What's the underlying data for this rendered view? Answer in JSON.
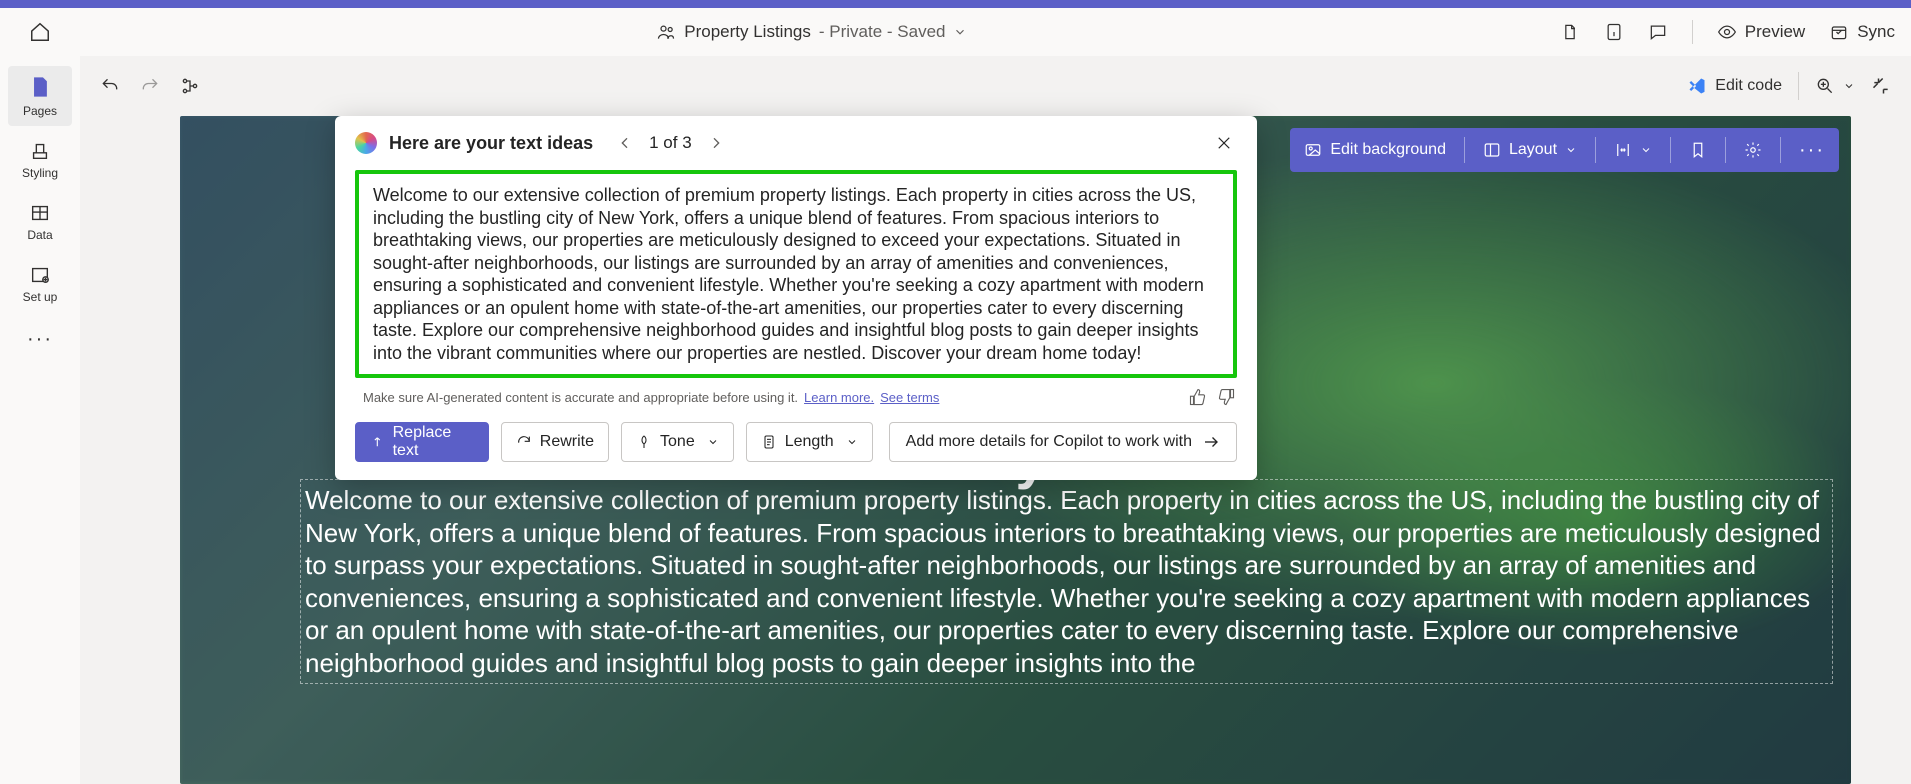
{
  "titlebar": {
    "doc_name": "Property Listings",
    "doc_status": "- Private - Saved",
    "preview": "Preview",
    "sync": "Sync"
  },
  "leftbar": {
    "pages": "Pages",
    "styling": "Styling",
    "data": "Data",
    "setup": "Set up"
  },
  "toolbar": {
    "edit_code": "Edit code"
  },
  "edit_strip": {
    "edit_bg": "Edit background",
    "layout": "Layout"
  },
  "hero": {
    "title_fragment": "cy",
    "body": "Welcome to our extensive collection of premium property listings. Each property in cities across the US, including the bustling city of New York, offers a unique blend of features. From spacious interiors to breathtaking views, our properties are meticulously designed to surpass your expectations. Situated in sought-after neighborhoods, our listings are surrounded by an array of amenities and conveniences, ensuring a sophisticated and convenient lifestyle. Whether you're seeking a cozy apartment with modern appliances or an opulent home with state-of-the-art amenities, our properties cater to every discerning taste. Explore our comprehensive neighborhood guides and insightful blog posts to gain deeper insights into the"
  },
  "popup": {
    "title": "Here are your text ideas",
    "pager": "1 of 3",
    "idea_text": "Welcome to our extensive collection of premium property listings. Each property in cities across the US, including the bustling city of New York, offers a unique blend of features. From spacious interiors to breathtaking views, our properties are meticulously designed to exceed your expectations. Situated in sought-after neighborhoods, our listings are surrounded by an array of amenities and conveniences, ensuring a sophisticated and convenient lifestyle. Whether you're seeking a cozy apartment with modern appliances or an opulent home with state-of-the-art amenities, our properties cater to every discerning taste. Explore our comprehensive neighborhood guides and insightful blog posts to gain deeper insights into the vibrant communities where our properties are nestled. Discover your dream home today!",
    "disclaimer": "Make sure AI-generated content is accurate and appropriate before using it.",
    "learn_more": "Learn more.",
    "see_terms": "See terms",
    "replace": "Replace text",
    "rewrite": "Rewrite",
    "tone": "Tone",
    "length": "Length",
    "add_more": "Add more details for Copilot to work with"
  }
}
